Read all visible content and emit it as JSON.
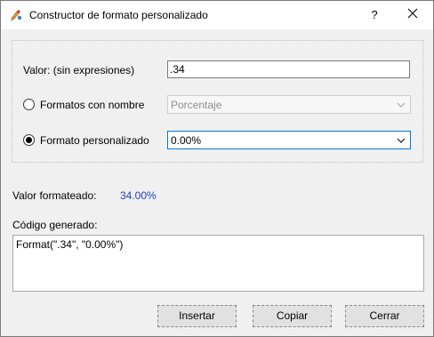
{
  "window": {
    "title": "Constructor de formato personalizado",
    "help_label": "?",
    "icons": {
      "app": "brush-palette-icon",
      "close": "close-icon"
    }
  },
  "form": {
    "value_label": "Valor: (sin expresiones)",
    "value_input": ".34",
    "named_formats_label": "Formatos con nombre",
    "named_formats_selected": "Porcentaje",
    "named_formats_enabled": false,
    "named_formats_checked": false,
    "custom_format_label": "Formato personalizado",
    "custom_format_value": "0.00%",
    "custom_format_checked": true
  },
  "result": {
    "formatted_label": "Valor formateado:",
    "formatted_value": "34.00%",
    "formatted_color": "#1f3fb8",
    "code_label": "Código generado:",
    "code_value": "Format(\".34\", \"0.00%\")"
  },
  "buttons": {
    "insert": "Insertar",
    "copy": "Copiar",
    "close": "Cerrar"
  }
}
